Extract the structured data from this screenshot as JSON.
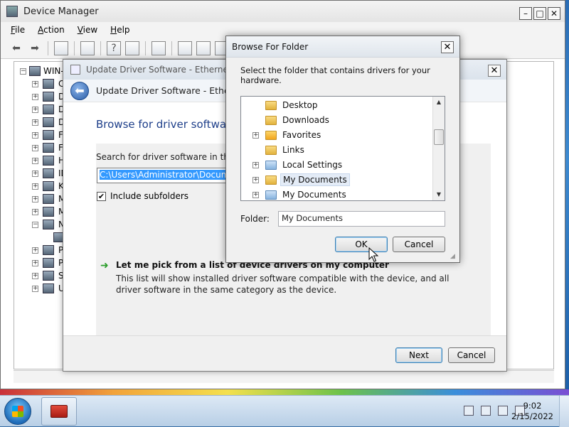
{
  "device_manager": {
    "title": "Device Manager",
    "menu": [
      "File",
      "Action",
      "View",
      "Help"
    ],
    "menu_mnemonics": [
      "F",
      "A",
      "V",
      "H"
    ],
    "tree_root": "WIN-",
    "tree_initials": [
      "C",
      "D",
      "D",
      "D",
      "F",
      "F",
      "H",
      "ID",
      "K",
      "M",
      "M",
      "N",
      "",
      "P",
      "P",
      "S",
      "U"
    ]
  },
  "update_driver": {
    "title": "Update Driver Software - Ethernet Cor",
    "nav_title": "Update Driver Software - Ethernet C",
    "heading": "Browse for driver software",
    "search_label": "Search for driver software in this lo",
    "path_value": "C:\\Users\\Administrator\\Documen",
    "include_subfolders": "Include subfolders",
    "pick_title": "Let me pick from a list of device drivers on my computer",
    "pick_desc": "This list will show installed driver software compatible with the device, and all driver software in the same category as the device.",
    "next_label": "Next",
    "cancel_label": "Cancel"
  },
  "browse_folder": {
    "title": "Browse For Folder",
    "instructions": "Select the folder that contains drivers for your hardware.",
    "folders": [
      {
        "label": "Desktop",
        "expandable": false,
        "icon": "folder-icon"
      },
      {
        "label": "Downloads",
        "expandable": false,
        "icon": "folder-icon"
      },
      {
        "label": "Favorites",
        "expandable": true,
        "icon": "favorites-icon"
      },
      {
        "label": "Links",
        "expandable": false,
        "icon": "folder-icon"
      },
      {
        "label": "Local Settings",
        "expandable": true,
        "icon": "shortcut-folder-icon"
      },
      {
        "label": "My Documents",
        "expandable": true,
        "icon": "folder-icon",
        "selected": true
      },
      {
        "label": "My Documents",
        "expandable": true,
        "icon": "shortcut-folder-icon"
      }
    ],
    "folder_label": "Folder:",
    "folder_value": "My Documents",
    "ok_label": "OK",
    "cancel_label": "Cancel"
  },
  "taskbar": {
    "time": "9:02",
    "date": "2/15/2022"
  }
}
